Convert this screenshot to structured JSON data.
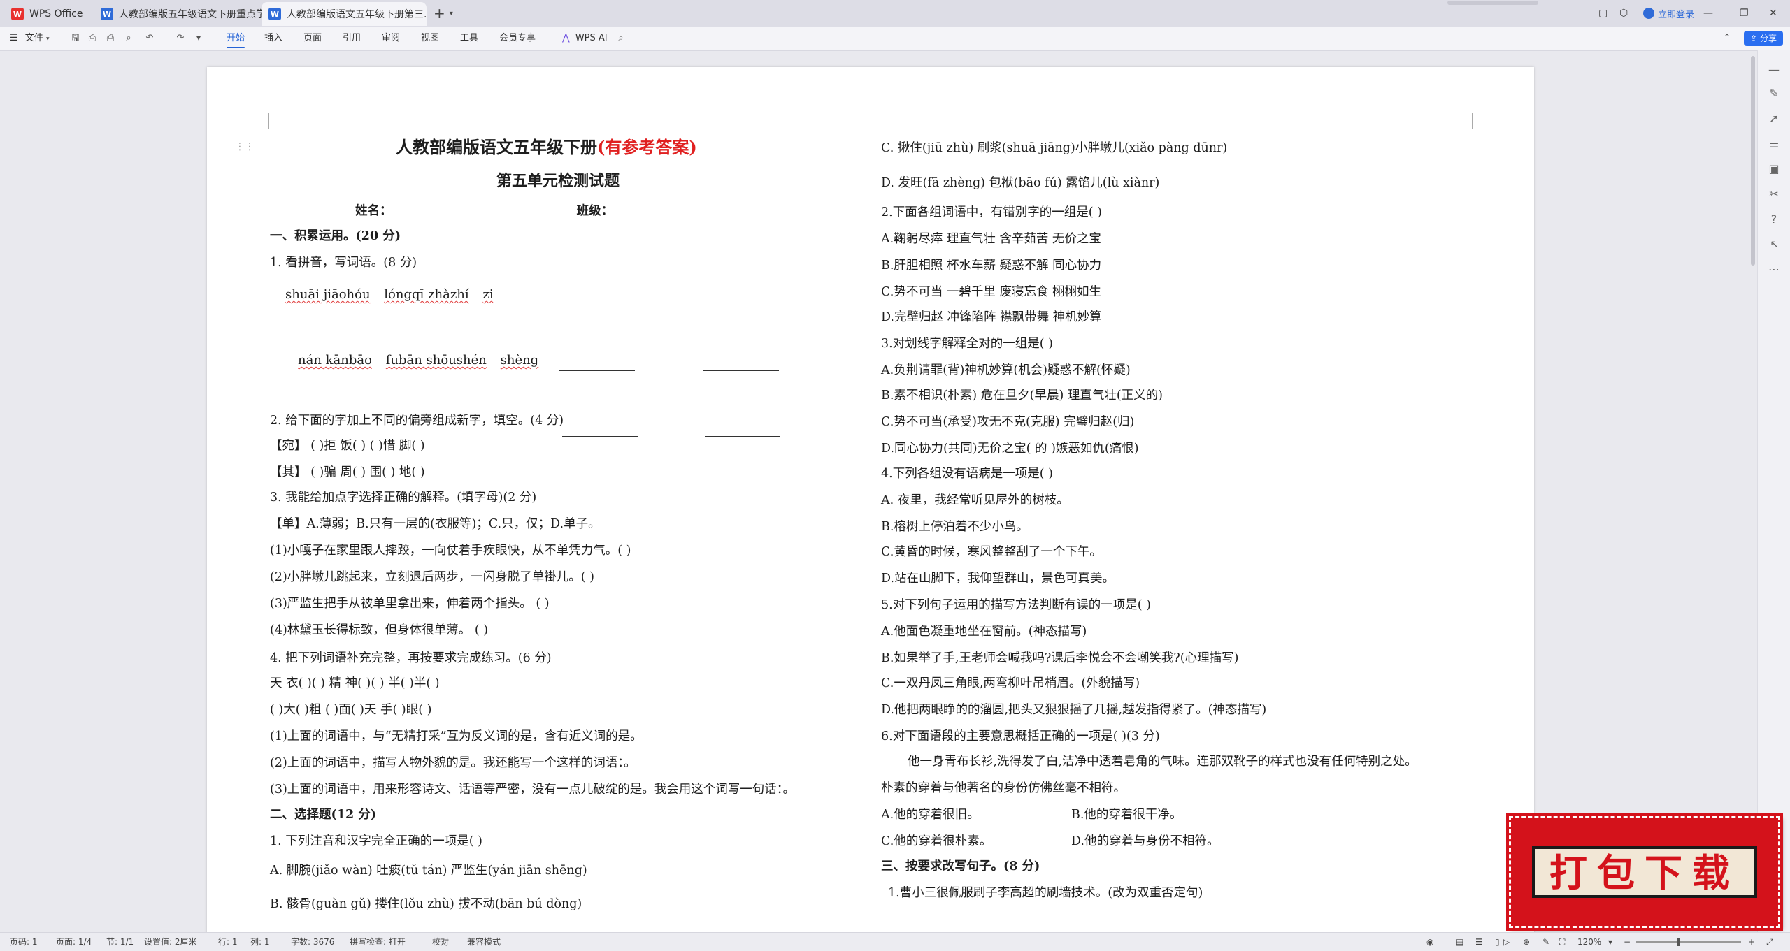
{
  "tabs": [
    {
      "icon_text": "W",
      "label": "WPS Office"
    },
    {
      "icon_text": "W",
      "label": "人教部编版五年级语文下册重点学校..."
    },
    {
      "icon_text": "W",
      "label": "人教部编版语文五年级下册第三..."
    }
  ],
  "titlebar": {
    "new_tab": "+",
    "login": "立即登录"
  },
  "menubar": {
    "file": "文件",
    "items": [
      "开始",
      "插入",
      "页面",
      "引用",
      "审阅",
      "视图",
      "工具",
      "会员专享"
    ],
    "wps_ai": "WPS AI",
    "share": "分享"
  },
  "doc": {
    "title_main": "人教部编版语文五年级下册",
    "title_tag": "(有参考答案)",
    "subtitle": "第五单元检测试题",
    "name_label": "姓名：",
    "class_label": "班级：",
    "left": {
      "s1": "一、积累运用。(20 分)",
      "q1": "1.  看拼音，写词语。(8 分)",
      "q1_py1": [
        "shuāi  jiāohóu",
        "lóngqī  zhàzhí",
        "zi"
      ],
      "q1_py2": [
        "nán  kānbāo",
        "fubān  shōushén",
        "shèng"
      ],
      "q2": "2.  给下面的字加上不同的偏旁组成新字，填空。(4 分)",
      "q2_r1": "【宛】   (      )拒       饭(      )       (      )惜        脚(      )",
      "q2_r2": "【其】   (      )骗       周(      )        围(      )        地(      )",
      "q3": "3.  我能给加点字选择正确的解释。(填字母)(2 分)",
      "q3_opts": "【单】A.薄弱；B.只有一层的(衣服等)；C.只，仅；D.单子。",
      "q3_1": "(1)小嘎子在家里跟人摔跤，一向仗着手疾眼快，从不单凭力气。(      )",
      "q3_2": "(2)小胖墩儿跳起来，立刻退后两步，一闪身脱了单褂儿。(      )",
      "q3_3": "(3)严监生把手从被单里拿出来，伸着两个指头。                  (      )",
      "q3_4": "(4)林黛玉长得标致，但身体很单薄。                               (      )",
      "q4": "  4.  把下列词语补充完整，再按要求完成练习。(6 分)",
      "q4_r1": "天  衣(      )(      ) 精  神(      )(      )  半(      )半(      )",
      "q4_r2": "(      )大(      )粗      (      )面(      )天       手(      )眼(      )",
      "q4_1": "(1)上面的词语中，与“无精打采”互为反义词的是，含有近义词的是。",
      "q4_2": "(2)上面的词语中，描写人物外貌的是。我还能写一个这样的词语：。",
      "q4_3": "(3)上面的词语中，用来形容诗文、话语等严密，没有一点儿破绽的是。我会用这个词写一句话：。",
      "s2": "二、选择题(12 分)",
      "c1": "1.  下列注音和汉字完全正确的一项是(      )",
      "c1_a": "A.  脚腕(jiǎo   wàn)   吐痰(tǔ  tán)         严监生(yán  jiān  shēng)",
      "c1_b": "B.  骸骨(guàn   gǔ)   搂住(lǒu    zhù)    拔不动(bān    bú    dòng)"
    },
    "right": {
      "c1_c": "C.  揪住(jiū  zhù) 刷浆(shuā   jiāng)小胖墩儿(xiǎo  pàng  dūnr)",
      "c1_d": "D.  发旺(fā   zhèng) 包袱(bāo   fú) 露馅儿(lù   xiànr)",
      "c2": "2.下面各组词语中，有错别字的一组是(      )",
      "c2_a": "A.鞠躬尽瘁       理直气壮        含辛茹苦   无价之宝",
      "c2_b": "B.肝胆相照       杯水车薪        疑惑不解   同心协力",
      "c2_c": "C.势不可当       一碧千里        废寝忘食   栩栩如生",
      "c2_d": "D.完壁归赵       冲锋陷阵        襟飘带舞      神机妙算",
      "c3": "3.对划线字解释全对的一组是(        )",
      "c3_a": "A.负荆请罪(背)神机妙算(机会)疑惑不解(怀疑)",
      "c3_b": "B.素不相识(朴素)      危在旦夕(早晨)      理直气壮(正义的)",
      "c3_c": "C.势不可当(承受)攻无不克(克服)      完璧归赵(归)",
      "c3_d": "D.同心协力(共同)无价之宝(      的    )嫉恶如仇(痛恨)",
      "c4": "4.下列各组没有语病是一项是(      )",
      "c4_a": "A.  夜里，我经常听见屋外的树枝。",
      "c4_b": "B.榕树上停泊着不少小鸟。",
      "c4_c": "C.黄昏的时候，寒风整整刮了一个下午。",
      "c4_d": "D.站在山脚下，我仰望群山，景色可真美。",
      "c5": "5.对下列句子运用的描写方法判断有误的一项是(      )",
      "c5_a": "A.他面色凝重地坐在窗前。(神态描写)",
      "c5_b": "B.如果举了手,王老师会喊我吗?课后李悦会不会嘲笑我?(心理描写)",
      "c5_c": "C.一双丹凤三角眼,两弯柳叶吊梢眉。(外貌描写)",
      "c5_d": "D.他把两眼睁的的溜圆,把头又狠狠摇了几摇,越发指得紧了。(神态描写)",
      "c6": "6.对下面语段的主要意思概括正确的一项是(      )(3 分)",
      "c6_p1": "他一身青布长衫,洗得发了白,洁净中透着皂角的气味。连那双靴子的样式也没有任何特别之处。",
      "c6_p2": "朴素的穿着与他著名的身份仿佛丝毫不相符。",
      "c6_a": "A.他的穿着很旧。",
      "c6_b": "B.他的穿着很干净。",
      "c6_c": "C.他的穿着很朴素。",
      "c6_d": "D.他的穿着与身份不相符。",
      "s3": "三、按要求改写句子。(8 分)",
      "r1": "1.曹小三很佩服刷子李高超的刷墙技术。(改为双重否定句)"
    }
  },
  "statusbar": {
    "page_code": "页码: 1",
    "page": "页面: 1/4",
    "section": "节: 1/1",
    "setting": "设置值: 2厘米",
    "row": "行: 1",
    "col": "列: 1",
    "wordcount": "字数: 3676",
    "spellcheck": "拼写检查: 打开",
    "proofread": "校对",
    "compat": "兼容模式",
    "zoom": "120%"
  },
  "badge": {
    "text": "打包下载"
  },
  "colors": {
    "accent": "#2563d6",
    "title_red": "#e02020",
    "badge_red": "#d4121b"
  }
}
